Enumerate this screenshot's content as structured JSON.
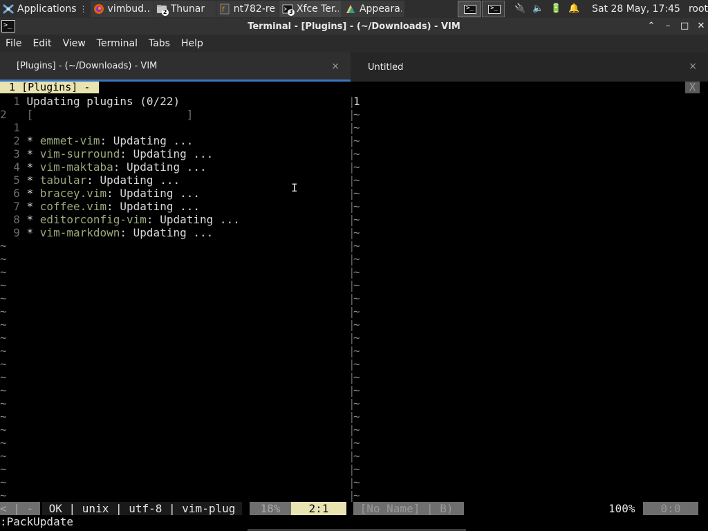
{
  "panel": {
    "apps_label": "Applications",
    "tasks": [
      {
        "title": "vimbud...",
        "icon": "firefox-icon",
        "count": ""
      },
      {
        "title": "Thunar",
        "icon": "folder-icon",
        "count": "2"
      },
      {
        "title": "nt782-re...",
        "icon": "spreadsheet-icon",
        "count": ""
      },
      {
        "title": "Xfce Ter...",
        "icon": "terminal-icon",
        "count": "3"
      },
      {
        "title": "Appeara...",
        "icon": "appearance-icon",
        "count": ""
      }
    ],
    "clock": "Sat 28 May, 17:45",
    "user": "root"
  },
  "window": {
    "title": "Terminal - [Plugins] - (~/Downloads) - VIM",
    "controls": {
      "up": "⌃",
      "minimize": "–",
      "maximize": "□",
      "close": "✕"
    }
  },
  "menubar": [
    "File",
    "Edit",
    "View",
    "Terminal",
    "Tabs",
    "Help"
  ],
  "tabs": [
    {
      "label": "[Plugins] - (~/Downloads) - VIM",
      "close": "×"
    },
    {
      "label": "Untitled",
      "close": "×"
    }
  ],
  "vim": {
    "tabline": " 1 [Plugins] - ",
    "tabline_close": "X",
    "left_lines": [
      {
        "num": "  1 ",
        "text": "Updating plugins (0/22)",
        "kind": "header"
      },
      {
        "num": "2   ",
        "text": "[                       ]",
        "kind": "bar"
      },
      {
        "num": "  1 ",
        "text": "",
        "kind": "blank"
      },
      {
        "num": "  2 ",
        "bullet": "* ",
        "name": "emmet-vim",
        "status": ": Updating ..."
      },
      {
        "num": "  3 ",
        "bullet": "* ",
        "name": "vim-surround",
        "status": ": Updating ..."
      },
      {
        "num": "  4 ",
        "bullet": "* ",
        "name": "vim-maktaba",
        "status": ": Updating ..."
      },
      {
        "num": "  5 ",
        "bullet": "* ",
        "name": "tabular",
        "status": ": Updating ..."
      },
      {
        "num": "  6 ",
        "bullet": "* ",
        "name": "bracey.vim",
        "status": ": Updating ..."
      },
      {
        "num": "  7 ",
        "bullet": "* ",
        "name": "coffee.vim",
        "status": ": Updating ..."
      },
      {
        "num": "  8 ",
        "bullet": "* ",
        "name": "editorconfig-vim",
        "status": ": Updating ..."
      },
      {
        "num": "  9 ",
        "bullet": "* ",
        "name": "vim-markdown",
        "status": ": Updating ..."
      }
    ],
    "tilde": "~",
    "right_first_line": "1",
    "statusline": {
      "mode": "< | - ",
      "info": " OK | unix | utf-8 | vim-plug ",
      "percent": " 18% ",
      "position": "  2:1  ",
      "right_name": " [No Name] | B) ",
      "right_percent": "100% ",
      "right_position": "  0:0  "
    },
    "command": ":PackUpdate"
  }
}
